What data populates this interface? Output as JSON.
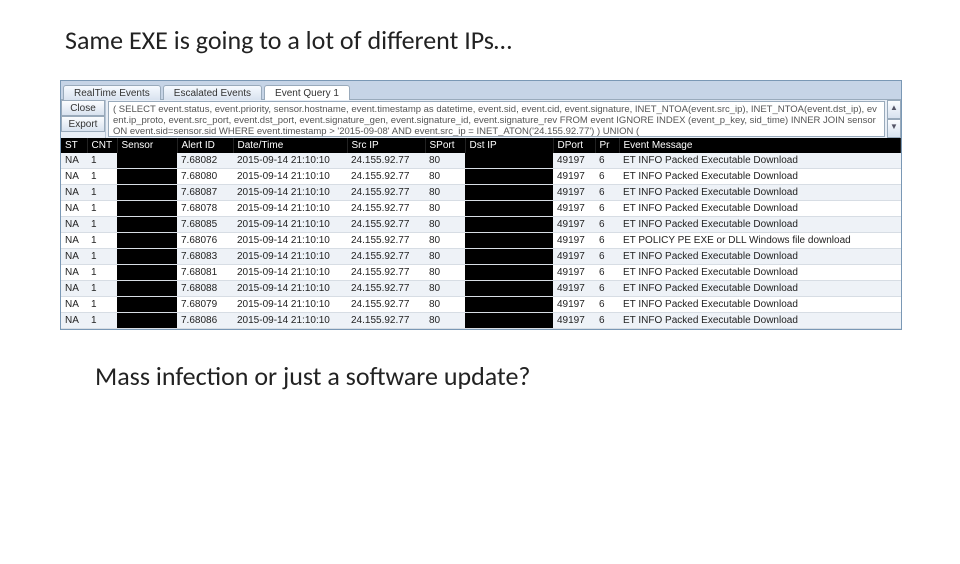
{
  "titles": {
    "top": "Same EXE is going to a lot of different IPs…",
    "bottom": "Mass infection or just a software update?"
  },
  "tabs": {
    "items": [
      {
        "label": "RealTime Events",
        "active": false
      },
      {
        "label": "Escalated Events",
        "active": false
      },
      {
        "label": "Event Query 1",
        "active": true
      }
    ]
  },
  "side_buttons": {
    "close": "Close",
    "export": "Export"
  },
  "query_text": "( SELECT event.status, event.priority, sensor.hostname,  event.timestamp as datetime, event.sid, event.cid, event.signature, INET_NTOA(event.src_ip), INET_NTOA(event.dst_ip), event.ip_proto, event.src_port, event.dst_port, event.signature_gen, event.signature_id,  event.signature_rev FROM event IGNORE INDEX (event_p_key, sid_time) INNER JOIN sensor ON event.sid=sensor.sid WHERE event.timestamp > '2015-09-08' AND  event.src_ip = INET_ATON('24.155.92.77') ) UNION (",
  "scroll": {
    "up": "▲",
    "down": "▼"
  },
  "columns": [
    "ST",
    "CNT",
    "Sensor",
    "Alert ID",
    "Date/Time",
    "Src IP",
    "SPort",
    "Dst IP",
    "DPort",
    "Pr",
    "Event Message"
  ],
  "rows": [
    {
      "st": "NA",
      "cnt": "1",
      "alert": "7.68082",
      "date": "2015-09-14 21:10:10",
      "srcip": "24.155.92.77",
      "sport": "80",
      "dport": "49197",
      "pr": "6",
      "msg": "ET INFO Packed Executable Download"
    },
    {
      "st": "NA",
      "cnt": "1",
      "alert": "7.68080",
      "date": "2015-09-14 21:10:10",
      "srcip": "24.155.92.77",
      "sport": "80",
      "dport": "49197",
      "pr": "6",
      "msg": "ET INFO Packed Executable Download"
    },
    {
      "st": "NA",
      "cnt": "1",
      "alert": "7.68087",
      "date": "2015-09-14 21:10:10",
      "srcip": "24.155.92.77",
      "sport": "80",
      "dport": "49197",
      "pr": "6",
      "msg": "ET INFO Packed Executable Download"
    },
    {
      "st": "NA",
      "cnt": "1",
      "alert": "7.68078",
      "date": "2015-09-14 21:10:10",
      "srcip": "24.155.92.77",
      "sport": "80",
      "dport": "49197",
      "pr": "6",
      "msg": "ET INFO Packed Executable Download"
    },
    {
      "st": "NA",
      "cnt": "1",
      "alert": "7.68085",
      "date": "2015-09-14 21:10:10",
      "srcip": "24.155.92.77",
      "sport": "80",
      "dport": "49197",
      "pr": "6",
      "msg": "ET INFO Packed Executable Download"
    },
    {
      "st": "NA",
      "cnt": "1",
      "alert": "7.68076",
      "date": "2015-09-14 21:10:10",
      "srcip": "24.155.92.77",
      "sport": "80",
      "dport": "49197",
      "pr": "6",
      "msg": "ET POLICY PE EXE or DLL Windows file download"
    },
    {
      "st": "NA",
      "cnt": "1",
      "alert": "7.68083",
      "date": "2015-09-14 21:10:10",
      "srcip": "24.155.92.77",
      "sport": "80",
      "dport": "49197",
      "pr": "6",
      "msg": "ET INFO Packed Executable Download"
    },
    {
      "st": "NA",
      "cnt": "1",
      "alert": "7.68081",
      "date": "2015-09-14 21:10:10",
      "srcip": "24.155.92.77",
      "sport": "80",
      "dport": "49197",
      "pr": "6",
      "msg": "ET INFO Packed Executable Download"
    },
    {
      "st": "NA",
      "cnt": "1",
      "alert": "7.68088",
      "date": "2015-09-14 21:10:10",
      "srcip": "24.155.92.77",
      "sport": "80",
      "dport": "49197",
      "pr": "6",
      "msg": "ET INFO Packed Executable Download"
    },
    {
      "st": "NA",
      "cnt": "1",
      "alert": "7.68079",
      "date": "2015-09-14 21:10:10",
      "srcip": "24.155.92.77",
      "sport": "80",
      "dport": "49197",
      "pr": "6",
      "msg": "ET INFO Packed Executable Download"
    },
    {
      "st": "NA",
      "cnt": "1",
      "alert": "7.68086",
      "date": "2015-09-14 21:10:10",
      "srcip": "24.155.92.77",
      "sport": "80",
      "dport": "49197",
      "pr": "6",
      "msg": "ET INFO Packed Executable Download"
    }
  ]
}
